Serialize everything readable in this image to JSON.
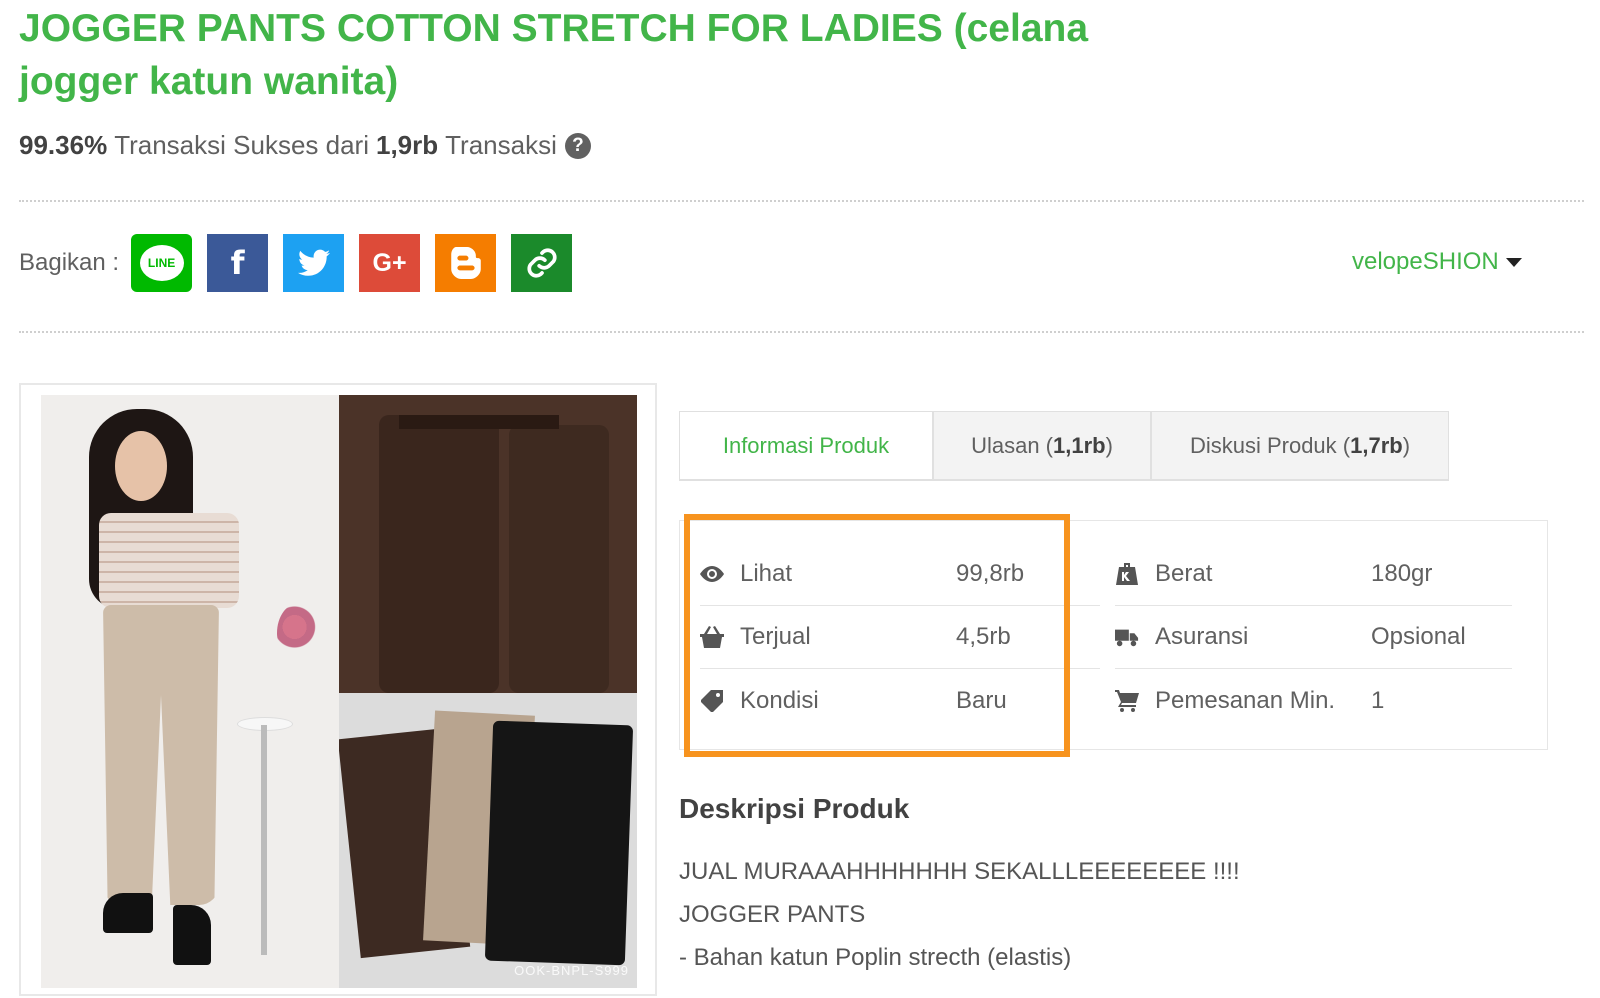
{
  "product": {
    "title": "JOGGER PANTS COTTON STRETCH FOR LADIES (celana jogger katun wanita)",
    "success_rate": "99.36%",
    "success_text": "Transaksi Sukses dari",
    "transactions": "1,9rb",
    "transactions_suffix": "Transaksi"
  },
  "share": {
    "label": "Bagikan :",
    "buttons": [
      {
        "name": "line",
        "text": "LINE",
        "color": "#00b900"
      },
      {
        "name": "facebook",
        "text": "f",
        "color": "#3b5998"
      },
      {
        "name": "twitter",
        "color": "#1da1f2"
      },
      {
        "name": "google-plus",
        "text": "G+",
        "color": "#dd4b39"
      },
      {
        "name": "blogger",
        "color": "#f57d00"
      },
      {
        "name": "copy-link",
        "color": "#1b8a2b"
      }
    ]
  },
  "seller": {
    "name": "velopeSHION"
  },
  "gallery": {
    "watermark": "OOK-BNPL-S999"
  },
  "tabs": [
    {
      "label": "Informasi Produk",
      "count": ""
    },
    {
      "label": "Ulasan (",
      "count": "1,1rb",
      "suffix": ")"
    },
    {
      "label": "Diskusi Produk (",
      "count": "1,7rb",
      "suffix": ")"
    }
  ],
  "info_left": [
    {
      "icon": "eye-icon",
      "label": "Lihat",
      "value": "99,8rb"
    },
    {
      "icon": "basket-icon",
      "label": "Terjual",
      "value": "4,5rb"
    },
    {
      "icon": "tag-icon",
      "label": "Kondisi",
      "value": "Baru"
    }
  ],
  "info_right": [
    {
      "icon": "weight-icon",
      "label": "Berat",
      "value": "180gr"
    },
    {
      "icon": "truck-icon",
      "label": "Asuransi",
      "value": "Opsional"
    },
    {
      "icon": "cart-icon",
      "label": "Pemesanan Min.",
      "value": "1"
    }
  ],
  "description": {
    "title": "Deskripsi Produk",
    "lines": [
      "JUAL MURAAAHHHHHHH SEKALLLEEEEEEEE !!!!",
      "JOGGER PANTS",
      "- Bahan katun Poplin strecth (elastis)"
    ]
  },
  "colors": {
    "brand_green": "#42b549",
    "highlight_orange": "#f7931e"
  }
}
